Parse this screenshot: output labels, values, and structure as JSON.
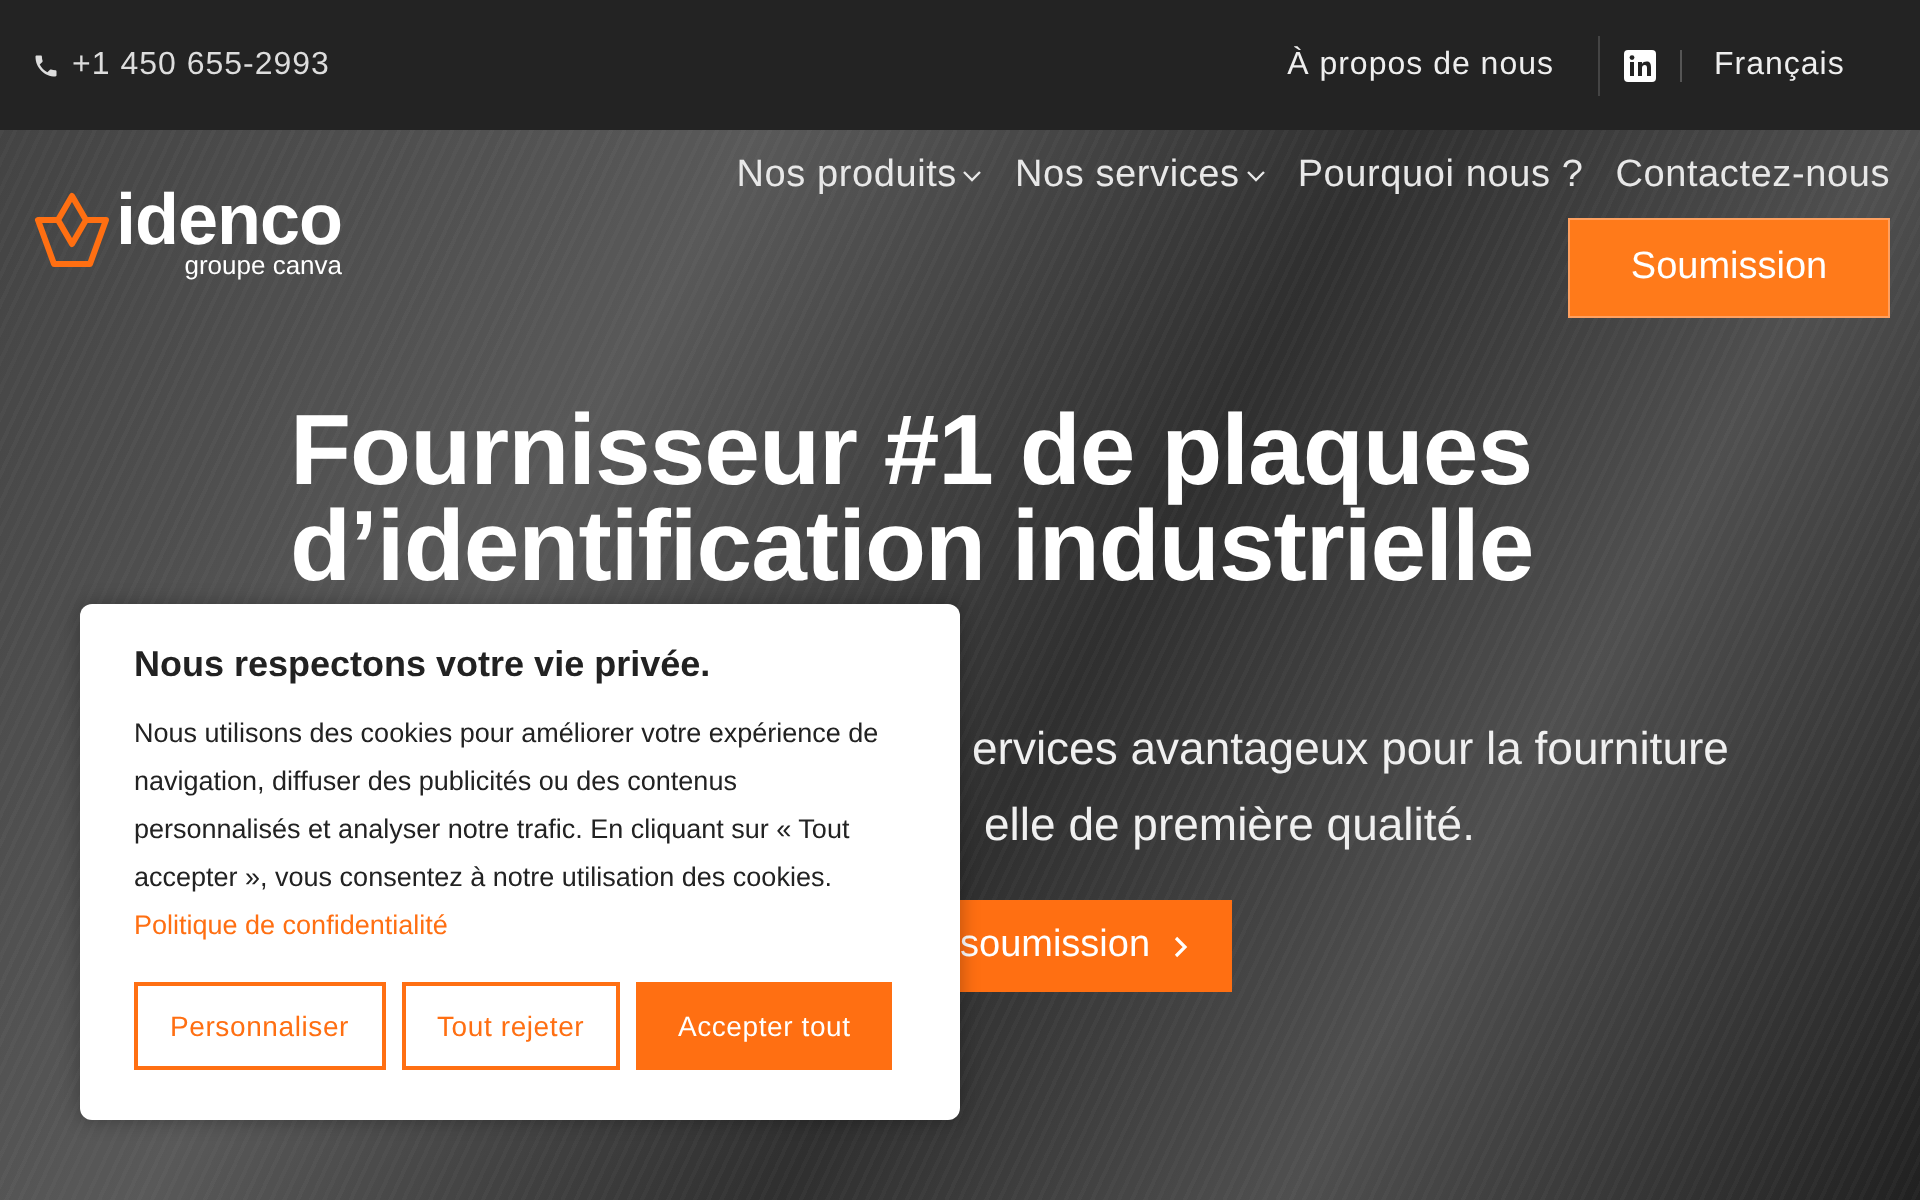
{
  "top_bar": {
    "phone": "+1 450 655-2993",
    "about_link": "À propos de nous",
    "language": "Français"
  },
  "header": {
    "logo_name": "idenco",
    "logo_tagline": "groupe canva",
    "nav": [
      {
        "label": "Nos produits",
        "has_menu": true
      },
      {
        "label": "Nos services",
        "has_menu": true
      },
      {
        "label": "Pourquoi nous ?",
        "has_menu": false
      },
      {
        "label": "Contactez-nous",
        "has_menu": false
      }
    ],
    "cta": "Soumission"
  },
  "hero": {
    "title": "Fournisseur #1 de plaques d’identification industrielle",
    "subtitle_lines": [
      "ervices avantageux pour la fourniture",
      "elle de première qualité."
    ],
    "button": "soumission"
  },
  "cookie_dialog": {
    "title": "Nous respectons votre vie privée.",
    "text": "Nous utilisons des cookies pour améliorer votre expérience de navigation, diffuser des publicités ou des contenus personnalisés et analyser notre trafic. En cliquant sur « Tout accepter », vous consentez à notre utilisation des cookies.",
    "link": "Politique de confidentialité",
    "buttons": [
      {
        "label": "Personnaliser",
        "kind": "outline"
      },
      {
        "label": "Tout rejeter",
        "kind": "outline"
      },
      {
        "label": "Accepter tout",
        "kind": "filled"
      }
    ]
  }
}
